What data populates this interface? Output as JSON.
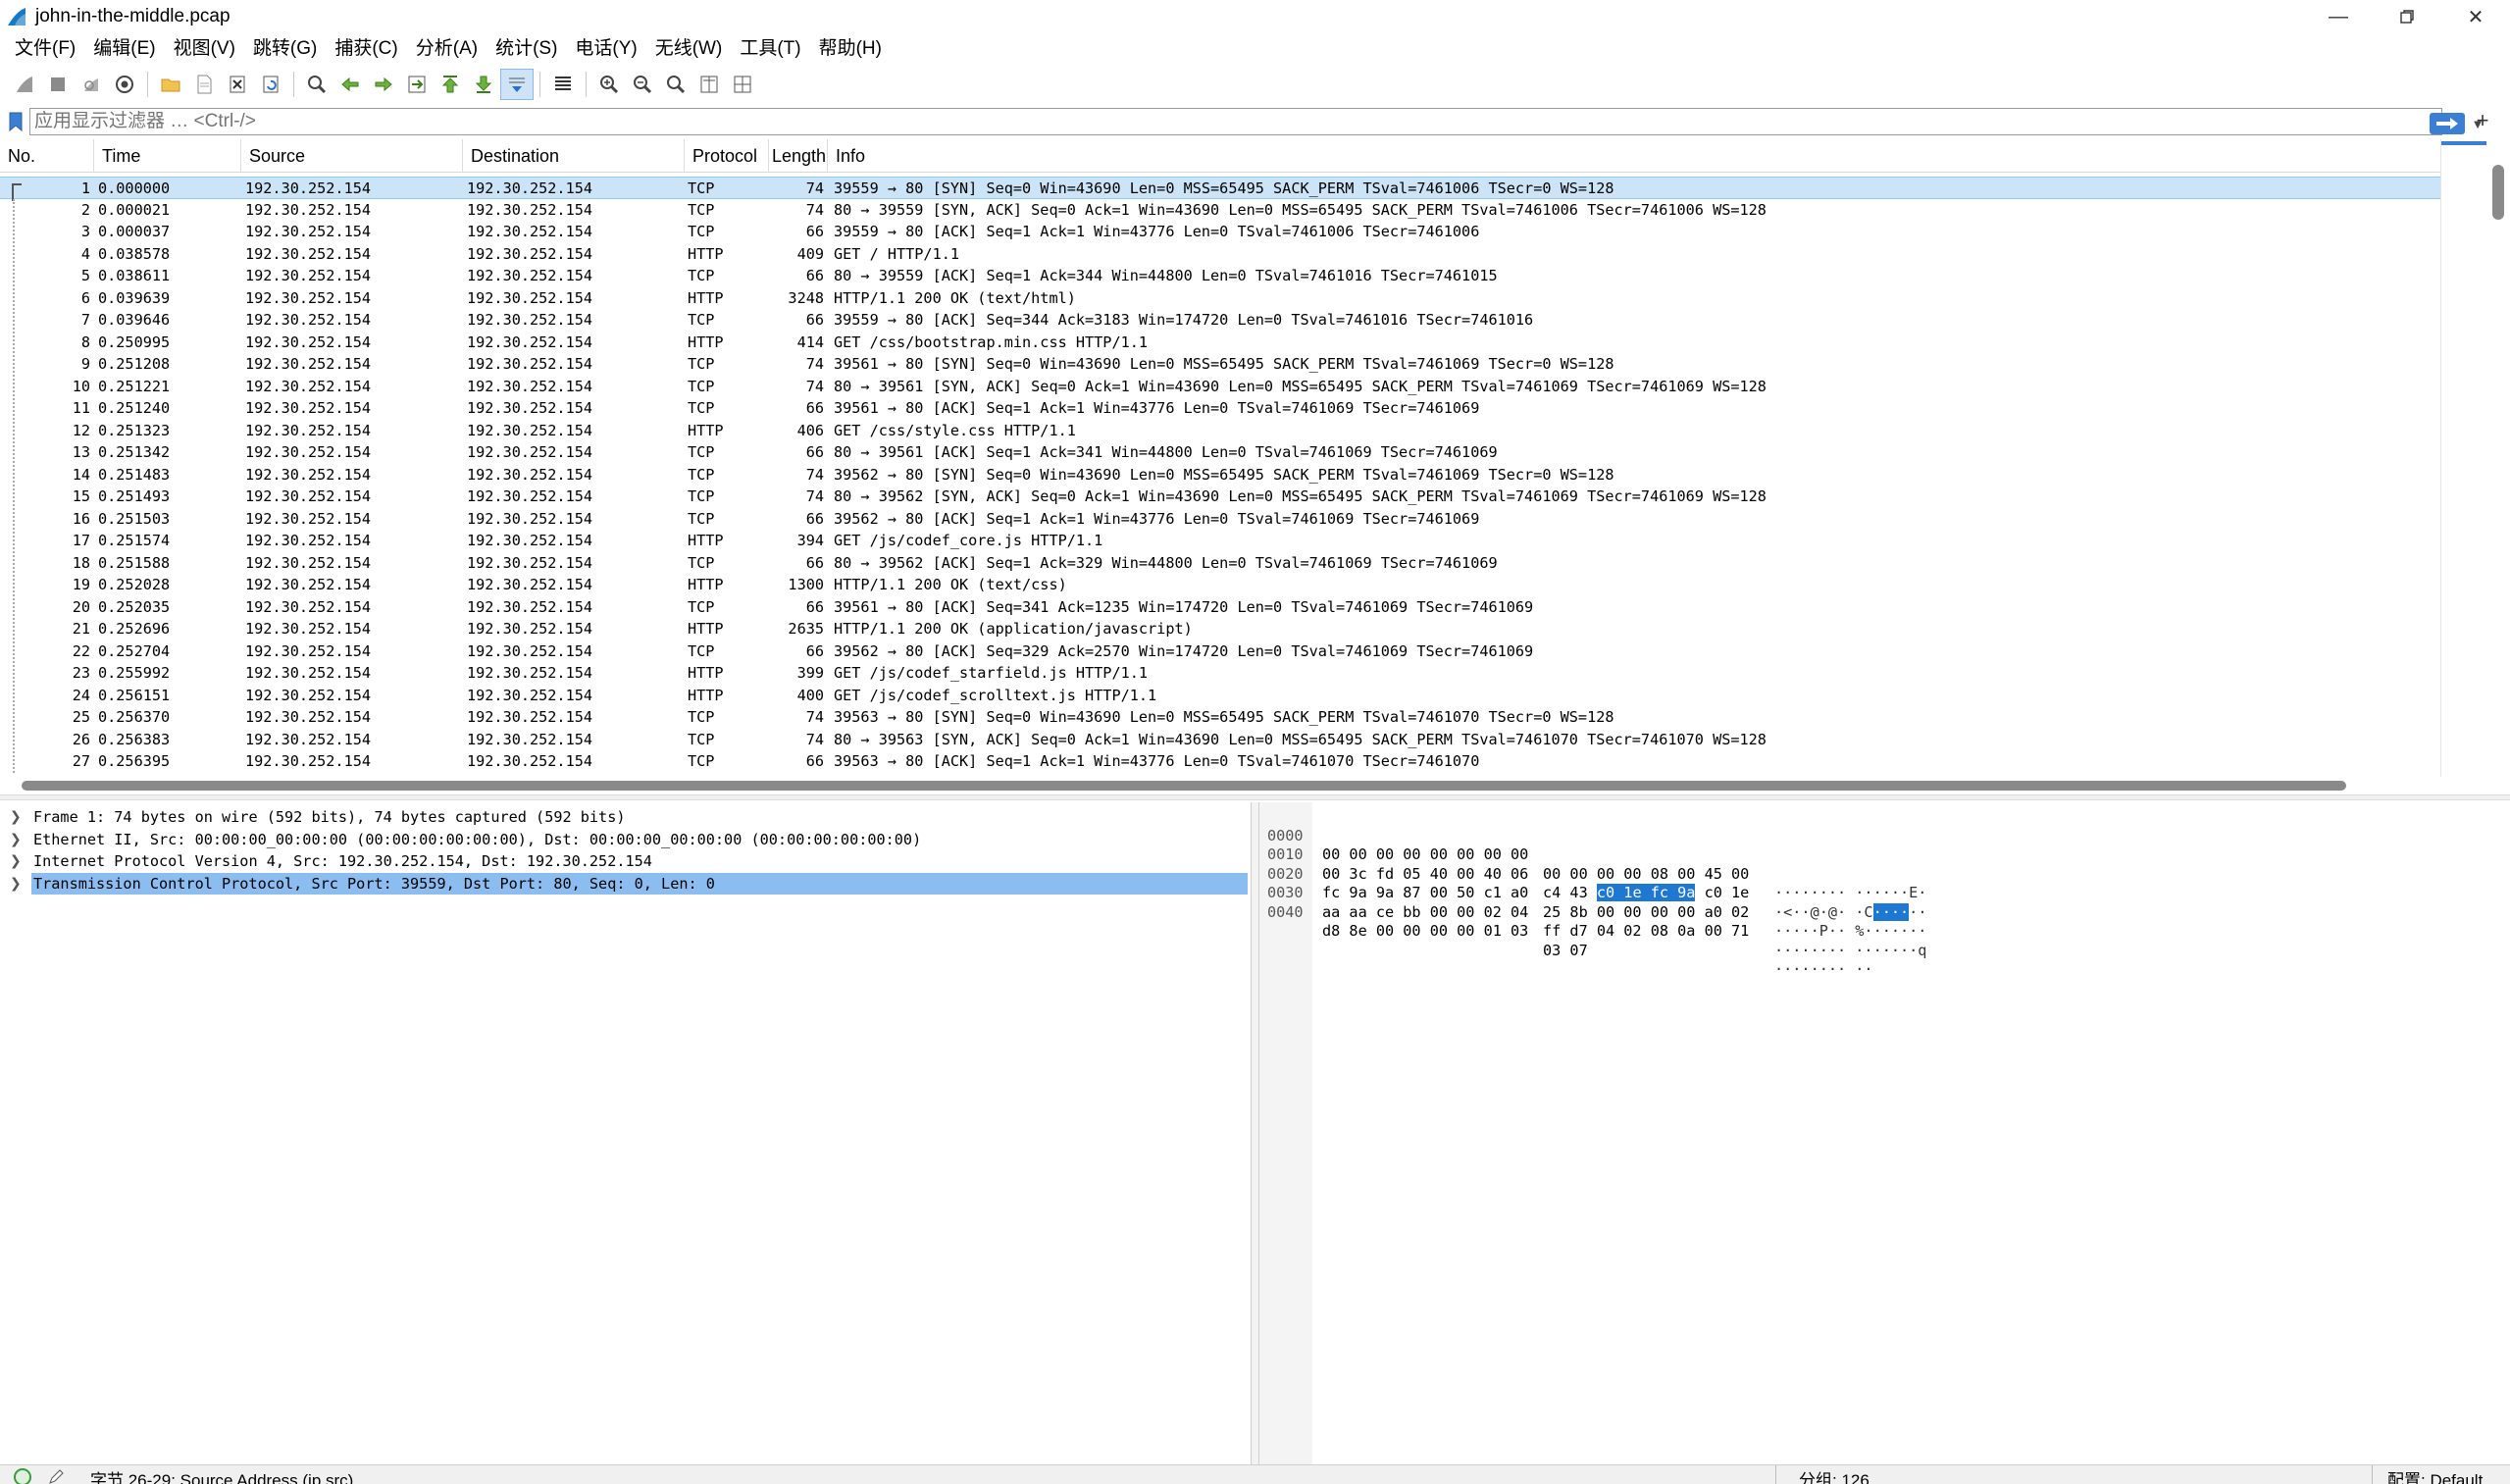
{
  "window": {
    "title": "john-in-the-middle.pcap"
  },
  "menu": [
    "文件(F)",
    "编辑(E)",
    "视图(V)",
    "跳转(G)",
    "捕获(C)",
    "分析(A)",
    "统计(S)",
    "电话(Y)",
    "无线(W)",
    "工具(T)",
    "帮助(H)"
  ],
  "filter": {
    "placeholder": "应用显示过滤器 … <Ctrl-/>",
    "add": "+"
  },
  "columns": {
    "no": "No.",
    "time": "Time",
    "source": "Source",
    "destination": "Destination",
    "protocol": "Protocol",
    "length": "Length",
    "info": "Info"
  },
  "packets": [
    {
      "no": "1",
      "time": "0.000000",
      "src": "192.30.252.154",
      "dst": "192.30.252.154",
      "proto": "TCP",
      "len": "74",
      "info": "39559 → 80 [SYN] Seq=0 Win=43690 Len=0 MSS=65495 SACK_PERM TSval=7461006 TSecr=0 WS=128"
    },
    {
      "no": "2",
      "time": "0.000021",
      "src": "192.30.252.154",
      "dst": "192.30.252.154",
      "proto": "TCP",
      "len": "74",
      "info": "80 → 39559 [SYN, ACK] Seq=0 Ack=1 Win=43690 Len=0 MSS=65495 SACK_PERM TSval=7461006 TSecr=7461006 WS=128"
    },
    {
      "no": "3",
      "time": "0.000037",
      "src": "192.30.252.154",
      "dst": "192.30.252.154",
      "proto": "TCP",
      "len": "66",
      "info": "39559 → 80 [ACK] Seq=1 Ack=1 Win=43776 Len=0 TSval=7461006 TSecr=7461006"
    },
    {
      "no": "4",
      "time": "0.038578",
      "src": "192.30.252.154",
      "dst": "192.30.252.154",
      "proto": "HTTP",
      "len": "409",
      "info": "GET / HTTP/1.1"
    },
    {
      "no": "5",
      "time": "0.038611",
      "src": "192.30.252.154",
      "dst": "192.30.252.154",
      "proto": "TCP",
      "len": "66",
      "info": "80 → 39559 [ACK] Seq=1 Ack=344 Win=44800 Len=0 TSval=7461016 TSecr=7461015"
    },
    {
      "no": "6",
      "time": "0.039639",
      "src": "192.30.252.154",
      "dst": "192.30.252.154",
      "proto": "HTTP",
      "len": "3248",
      "info": "HTTP/1.1 200 OK  (text/html)"
    },
    {
      "no": "7",
      "time": "0.039646",
      "src": "192.30.252.154",
      "dst": "192.30.252.154",
      "proto": "TCP",
      "len": "66",
      "info": "39559 → 80 [ACK] Seq=344 Ack=3183 Win=174720 Len=0 TSval=7461016 TSecr=7461016"
    },
    {
      "no": "8",
      "time": "0.250995",
      "src": "192.30.252.154",
      "dst": "192.30.252.154",
      "proto": "HTTP",
      "len": "414",
      "info": "GET /css/bootstrap.min.css HTTP/1.1"
    },
    {
      "no": "9",
      "time": "0.251208",
      "src": "192.30.252.154",
      "dst": "192.30.252.154",
      "proto": "TCP",
      "len": "74",
      "info": "39561 → 80 [SYN] Seq=0 Win=43690 Len=0 MSS=65495 SACK_PERM TSval=7461069 TSecr=0 WS=128"
    },
    {
      "no": "10",
      "time": "0.251221",
      "src": "192.30.252.154",
      "dst": "192.30.252.154",
      "proto": "TCP",
      "len": "74",
      "info": "80 → 39561 [SYN, ACK] Seq=0 Ack=1 Win=43690 Len=0 MSS=65495 SACK_PERM TSval=7461069 TSecr=7461069 WS=128"
    },
    {
      "no": "11",
      "time": "0.251240",
      "src": "192.30.252.154",
      "dst": "192.30.252.154",
      "proto": "TCP",
      "len": "66",
      "info": "39561 → 80 [ACK] Seq=1 Ack=1 Win=43776 Len=0 TSval=7461069 TSecr=7461069"
    },
    {
      "no": "12",
      "time": "0.251323",
      "src": "192.30.252.154",
      "dst": "192.30.252.154",
      "proto": "HTTP",
      "len": "406",
      "info": "GET /css/style.css HTTP/1.1"
    },
    {
      "no": "13",
      "time": "0.251342",
      "src": "192.30.252.154",
      "dst": "192.30.252.154",
      "proto": "TCP",
      "len": "66",
      "info": "80 → 39561 [ACK] Seq=1 Ack=341 Win=44800 Len=0 TSval=7461069 TSecr=7461069"
    },
    {
      "no": "14",
      "time": "0.251483",
      "src": "192.30.252.154",
      "dst": "192.30.252.154",
      "proto": "TCP",
      "len": "74",
      "info": "39562 → 80 [SYN] Seq=0 Win=43690 Len=0 MSS=65495 SACK_PERM TSval=7461069 TSecr=0 WS=128"
    },
    {
      "no": "15",
      "time": "0.251493",
      "src": "192.30.252.154",
      "dst": "192.30.252.154",
      "proto": "TCP",
      "len": "74",
      "info": "80 → 39562 [SYN, ACK] Seq=0 Ack=1 Win=43690 Len=0 MSS=65495 SACK_PERM TSval=7461069 TSecr=7461069 WS=128"
    },
    {
      "no": "16",
      "time": "0.251503",
      "src": "192.30.252.154",
      "dst": "192.30.252.154",
      "proto": "TCP",
      "len": "66",
      "info": "39562 → 80 [ACK] Seq=1 Ack=1 Win=43776 Len=0 TSval=7461069 TSecr=7461069"
    },
    {
      "no": "17",
      "time": "0.251574",
      "src": "192.30.252.154",
      "dst": "192.30.252.154",
      "proto": "HTTP",
      "len": "394",
      "info": "GET /js/codef_core.js HTTP/1.1"
    },
    {
      "no": "18",
      "time": "0.251588",
      "src": "192.30.252.154",
      "dst": "192.30.252.154",
      "proto": "TCP",
      "len": "66",
      "info": "80 → 39562 [ACK] Seq=1 Ack=329 Win=44800 Len=0 TSval=7461069 TSecr=7461069"
    },
    {
      "no": "19",
      "time": "0.252028",
      "src": "192.30.252.154",
      "dst": "192.30.252.154",
      "proto": "HTTP",
      "len": "1300",
      "info": "HTTP/1.1 200 OK  (text/css)"
    },
    {
      "no": "20",
      "time": "0.252035",
      "src": "192.30.252.154",
      "dst": "192.30.252.154",
      "proto": "TCP",
      "len": "66",
      "info": "39561 → 80 [ACK] Seq=341 Ack=1235 Win=174720 Len=0 TSval=7461069 TSecr=7461069"
    },
    {
      "no": "21",
      "time": "0.252696",
      "src": "192.30.252.154",
      "dst": "192.30.252.154",
      "proto": "HTTP",
      "len": "2635",
      "info": "HTTP/1.1 200 OK  (application/javascript)"
    },
    {
      "no": "22",
      "time": "0.252704",
      "src": "192.30.252.154",
      "dst": "192.30.252.154",
      "proto": "TCP",
      "len": "66",
      "info": "39562 → 80 [ACK] Seq=329 Ack=2570 Win=174720 Len=0 TSval=7461069 TSecr=7461069"
    },
    {
      "no": "23",
      "time": "0.255992",
      "src": "192.30.252.154",
      "dst": "192.30.252.154",
      "proto": "HTTP",
      "len": "399",
      "info": "GET /js/codef_starfield.js HTTP/1.1"
    },
    {
      "no": "24",
      "time": "0.256151",
      "src": "192.30.252.154",
      "dst": "192.30.252.154",
      "proto": "HTTP",
      "len": "400",
      "info": "GET /js/codef_scrolltext.js HTTP/1.1"
    },
    {
      "no": "25",
      "time": "0.256370",
      "src": "192.30.252.154",
      "dst": "192.30.252.154",
      "proto": "TCP",
      "len": "74",
      "info": "39563 → 80 [SYN] Seq=0 Win=43690 Len=0 MSS=65495 SACK_PERM TSval=7461070 TSecr=0 WS=128"
    },
    {
      "no": "26",
      "time": "0.256383",
      "src": "192.30.252.154",
      "dst": "192.30.252.154",
      "proto": "TCP",
      "len": "74",
      "info": "80 → 39563 [SYN, ACK] Seq=0 Ack=1 Win=43690 Len=0 MSS=65495 SACK_PERM TSval=7461070 TSecr=7461070 WS=128"
    },
    {
      "no": "27",
      "time": "0.256395",
      "src": "192.30.252.154",
      "dst": "192.30.252.154",
      "proto": "TCP",
      "len": "66",
      "info": "39563 → 80 [ACK] Seq=1 Ack=1 Win=43776 Len=0 TSval=7461070 TSecr=7461070"
    }
  ],
  "details": [
    {
      "text": "Frame 1: 74 bytes on wire (592 bits), 74 bytes captured (592 bits)",
      "selected": false
    },
    {
      "text": "Ethernet II, Src: 00:00:00_00:00:00 (00:00:00:00:00:00), Dst: 00:00:00_00:00:00 (00:00:00:00:00:00)",
      "selected": false
    },
    {
      "text": "Internet Protocol Version 4, Src: 192.30.252.154, Dst: 192.30.252.154",
      "selected": false
    },
    {
      "text": "Transmission Control Protocol, Src Port: 39559, Dst Port: 80, Seq: 0, Len: 0",
      "selected": true
    }
  ],
  "bytes": [
    {
      "offset": "0000",
      "hex1": "00 00 00 00 00 00 00 00",
      "hex2": "00 00 00 00 08 00 45 00",
      "ascii": "········ ······E·"
    },
    {
      "offset": "0010",
      "hex1": "00 3c fd 05 40 00 40 06",
      "hex2a": "c4 43 ",
      "hex2sel": "c0 1e fc 9a",
      "hex2b": " c0 1e",
      "asciia": "·<··@·@· ·C",
      "asciisel": "····",
      "asciib": "··"
    },
    {
      "offset": "0020",
      "hex1": "fc 9a 9a 87 00 50 c1 a0",
      "hex2": "25 8b 00 00 00 00 a0 02",
      "ascii": "·····P·· %·······"
    },
    {
      "offset": "0030",
      "hex1": "aa aa ce bb 00 00 02 04",
      "hex2": "ff d7 04 02 08 0a 00 71",
      "ascii": "········ ·······q"
    },
    {
      "offset": "0040",
      "hex1": "d8 8e 00 00 00 00 01 03",
      "hex2": "03 07",
      "ascii": "········ ··"
    }
  ],
  "status": {
    "left": "字节 26-29: Source Address (ip.src)",
    "packets": "分组: 126",
    "profile": "配置: Default"
  },
  "colors": {
    "selectedRow": "#cce4f7",
    "selectedDetail": "#8cbdf0",
    "hexHighlight": "#1e78d2",
    "accent": "#3b7fd4"
  }
}
